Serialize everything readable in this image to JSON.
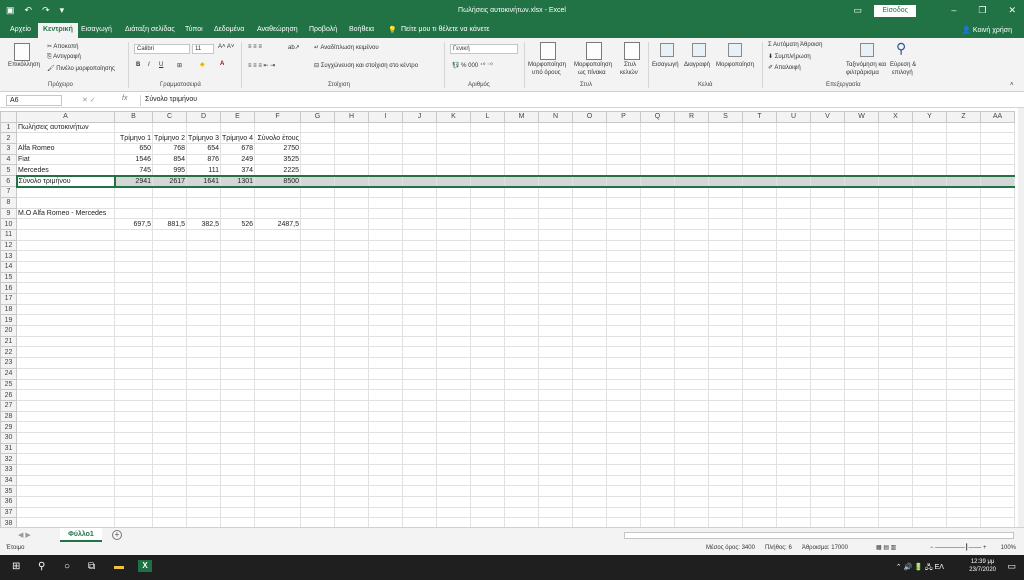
{
  "window": {
    "title": "Πωλήσεις αυτοκινήτων.xlsx - Excel",
    "signin": "Είσοδος"
  },
  "tabs": [
    "Αρχείο",
    "Κεντρική",
    "Εισαγωγή",
    "Διάταξη σελίδας",
    "Τύποι",
    "Δεδομένα",
    "Αναθεώρηση",
    "Προβολή",
    "Βοήθεια"
  ],
  "tell_me": "Πείτε μου τι θέλετε να κάνετε",
  "share": "Κοινή χρήση",
  "ribbon": {
    "paste": "Επικόλληση",
    "cut": "Αποκοπή",
    "copy": "Αντιγραφή",
    "format_painter": "Πινέλο μορφοποίησης",
    "clipboard": "Πρόχειρο",
    "font_name": "Calibri",
    "font_size": "11",
    "font_group": "Γραμματοσειρά",
    "wrap_text": "Αναδίπλωση κειμένου",
    "merge_center": "Συγχώνευση και στοίχιση στο κέντρο",
    "alignment": "Στοίχιση",
    "number_format": "Γενική",
    "number": "Αριθμός",
    "cond_format_1": "Μορφοποίηση",
    "cond_format_2": "υπό όρους",
    "format_table_1": "Μορφοποίηση",
    "format_table_2": "ως πίνακα",
    "cell_styles_1": "Στυλ",
    "cell_styles_2": "κελιών",
    "styles": "Στυλ",
    "insert": "Εισαγωγή",
    "delete": "Διαγραφή",
    "format": "Μορφοποίηση",
    "cells": "Κελιά",
    "autosum": "Αυτόματη Άθροιση",
    "fill": "Συμπλήρωση",
    "clear": "Απαλοιφή",
    "sort_filter_1": "Ταξινόμηση και",
    "sort_filter_2": "φιλτράρισμα",
    "find_select_1": "Εύρεση &",
    "find_select_2": "επιλογή",
    "editing": "Επεξεργασία"
  },
  "formula_bar": {
    "name_box": "A6",
    "fx": "fx",
    "formula": "Σύνολο τριμήνου"
  },
  "columns": [
    "A",
    "B",
    "C",
    "D",
    "E",
    "F",
    "G",
    "H",
    "I",
    "J",
    "K",
    "L",
    "M",
    "N",
    "O",
    "P",
    "Q",
    "R",
    "S",
    "T",
    "U",
    "V",
    "W",
    "X",
    "Y",
    "Z",
    "AA"
  ],
  "rows": [
    [
      "Πωλήσεις αυτοκινήτων",
      "",
      "",
      "",
      "",
      ""
    ],
    [
      "",
      "Τρίμηνο 1",
      "Τρίμηνο 2",
      "Τρίμηνο 3",
      "Τρίμηνο 4",
      "Σύνολο έτους"
    ],
    [
      "Alfa Romeo",
      "650",
      "768",
      "654",
      "678",
      "2750"
    ],
    [
      "Fiat",
      "1546",
      "854",
      "876",
      "249",
      "3525"
    ],
    [
      "Mercedes",
      "745",
      "995",
      "111",
      "374",
      "2225"
    ],
    [
      "Σύνολο τριμήνου",
      "2941",
      "2617",
      "1641",
      "1301",
      "8500"
    ],
    [
      "",
      "",
      "",
      "",
      "",
      ""
    ],
    [
      "",
      "",
      "",
      "",
      "",
      ""
    ],
    [
      "M.O Alfa Romeo - Mercedes",
      "",
      "",
      "",
      "",
      ""
    ],
    [
      "",
      "697,5",
      "881,5",
      "382,5",
      "526",
      "2487,5"
    ]
  ],
  "row_count": 38,
  "selected_row": 6,
  "sheet_tab": "Φύλλο1",
  "status": {
    "ready": "Έτοιμο",
    "average": "Μέσος όρος: 3400",
    "count": "Πλήθος: 6",
    "sum": "Άθροισμα: 17000",
    "zoom": "100%"
  },
  "taskbar": {
    "time": "12:39 μμ",
    "date": "23/7/2020",
    "lang": "ΕΛ"
  }
}
